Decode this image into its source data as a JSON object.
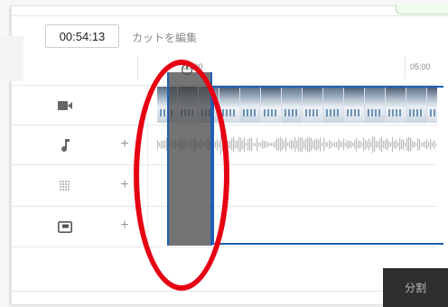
{
  "editor": {
    "current_time": "00:54:13",
    "edit_cuts_label": "カットを編集",
    "ruler": {
      "start_label": "00:00",
      "mark_label": "05:00"
    },
    "tracks": [
      {
        "name": "video",
        "icon": "video-camera-icon"
      },
      {
        "name": "audio",
        "icon": "music-note-icon",
        "add_label": "+"
      },
      {
        "name": "effects",
        "icon": "dots-grid-icon",
        "add_label": "+"
      },
      {
        "name": "annotations",
        "icon": "picture-in-picture-icon",
        "add_label": "+"
      }
    ],
    "split_label": "分割"
  },
  "colors": {
    "selection_blue": "#1e5fb4",
    "annotation_red": "#e60012",
    "split_button_bg": "#2f2f2f"
  }
}
